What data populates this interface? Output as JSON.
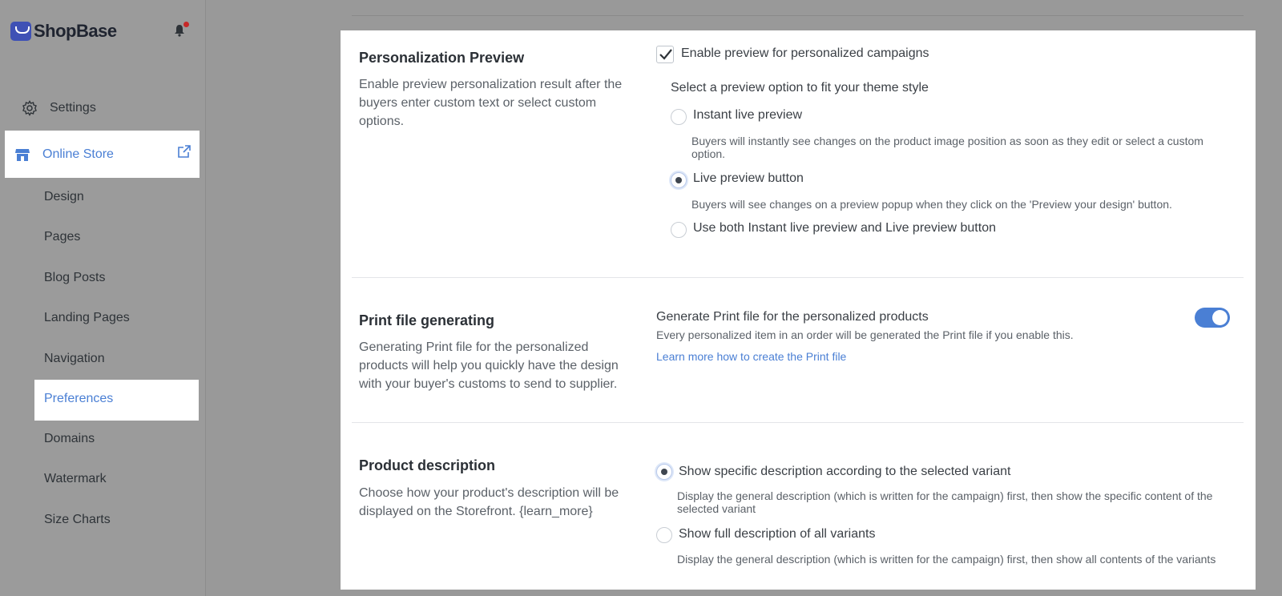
{
  "brand": {
    "name": "ShopBase"
  },
  "sidebar": {
    "settings_label": "Settings",
    "online_store_label": "Online Store",
    "items": [
      "Design",
      "Pages",
      "Blog Posts",
      "Landing Pages",
      "Navigation",
      "Preferences",
      "Domains",
      "Watermark",
      "Size Charts"
    ],
    "active_item": "Preferences"
  },
  "personalization": {
    "title": "Personalization Preview",
    "description": "Enable preview personalization result after the buyers enter custom text or select custom options.",
    "enable_label": "Enable preview for personalized campaigns",
    "enable_checked": true,
    "option_prompt": "Select a preview option to fit your theme style",
    "options": [
      {
        "label": "Instant live preview",
        "help": "Buyers will instantly see changes on the product image position as soon as they edit or select a custom option.",
        "selected": false
      },
      {
        "label": "Live preview button",
        "help": "Buyers will see changes on a preview popup when they click on the 'Preview your design' button.",
        "selected": true
      },
      {
        "label": "Use both Instant live preview and Live preview button",
        "help": "",
        "selected": false
      }
    ]
  },
  "print_file": {
    "title": "Print file generating",
    "description": "Generating Print file for the personalized products will help you quickly have the design with your buyer's customs to send to supplier.",
    "setting_label": "Generate Print file for the personalized products",
    "setting_help": "Every personalized item in an order will be generated the Print file if you enable this.",
    "link_text": "Learn more how to create the Print file",
    "enabled": true
  },
  "product_description": {
    "title": "Product description",
    "description": "Choose how your product's description will be displayed on the Storefront. {learn_more}",
    "options": [
      {
        "label": "Show specific description according to the selected variant",
        "help": "Display the general description (which is written for the campaign) first, then show the specific content of the selected variant",
        "selected": true
      },
      {
        "label": "Show full description of all variants",
        "help": "Display the general description (which is written for the campaign) first, then show all contents of the variants",
        "selected": false
      }
    ]
  },
  "colors": {
    "accent": "#4a7fd4",
    "brand": "#3f51b5",
    "notification": "#c62828"
  }
}
